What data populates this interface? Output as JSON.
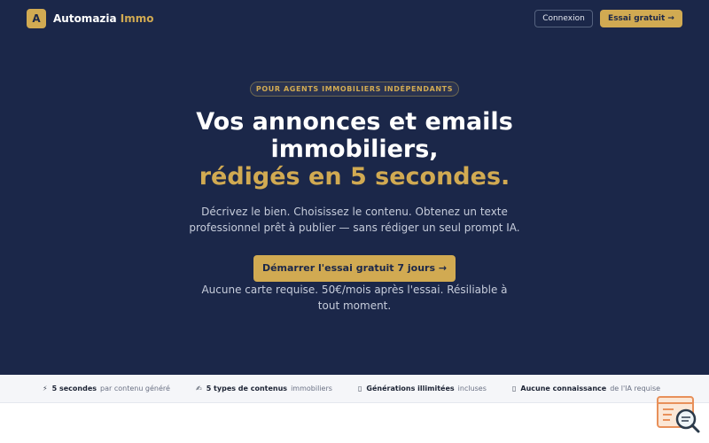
{
  "brand": {
    "logo_letter": "A",
    "name": "Automazia",
    "name_accent": "Immo"
  },
  "nav": {
    "login_label": "Connexion",
    "trial_label": "Essai gratuit →"
  },
  "hero": {
    "pill": "POUR AGENTS IMMOBILIERS INDÉPENDANTS",
    "title_line1": "Vos annonces et emails",
    "title_line2": "immobiliers,",
    "title_line3": "rédigés en 5 secondes.",
    "subtitle": "Décrivez le bien. Choisissez le contenu. Obtenez un texte professionnel prêt à publier — sans rédiger un seul prompt IA.",
    "cta_label": "Démarrer l'essai gratuit 7 jours →",
    "note": "Aucune carte requise. 50€/mois après l'essai. Résiliable à tout moment."
  },
  "features": [
    {
      "icon": "⚡",
      "icon_name": "lightning-icon",
      "bold": "5 secondes",
      "text": "par contenu généré"
    },
    {
      "icon": "✍",
      "icon_name": "writing-hand-icon",
      "bold": "5 types de contenus",
      "text": "immobiliers"
    },
    {
      "icon": "▯",
      "icon_name": "infinity-icon",
      "bold": "Générations illimitées",
      "text": "incluses"
    },
    {
      "icon": "▯",
      "icon_name": "target-icon",
      "bold": "Aucune connaissance",
      "text": "de l'IA requise"
    }
  ],
  "colors": {
    "navy": "#1b2749",
    "gold": "#d1aa52",
    "text_light": "#c6ccdb"
  }
}
